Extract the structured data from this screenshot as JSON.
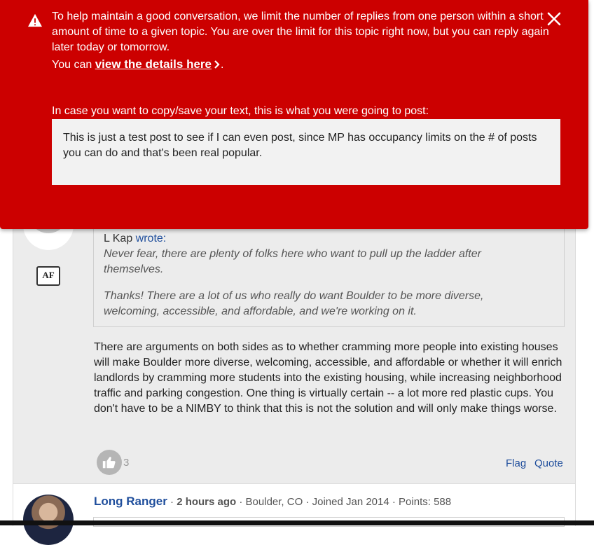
{
  "alert": {
    "message": "To help maintain a good conversation, we limit the number of replies from one person within a short amount of time to a given topic. You are over the limit for this topic right now, but you can reply again later today or tomorrow.",
    "details_prefix": "You can ",
    "details_link": "view the details here",
    "details_suffix": ".",
    "copy_label": "In case you want to copy/save your text, this is what you were going to post:",
    "draft_text": "This is just a test post to see if I can even post, since MP has occupancy limits on the # of posts you can do and that's been real popular.",
    "background_color": "#cc0000"
  },
  "post": {
    "badge_text": "AF",
    "quote": {
      "author": "L Kap",
      "wrote": "wrote:",
      "paragraph1": "Never fear, there are plenty of folks here who want to pull up the ladder after themselves.",
      "paragraph2": "Thanks! There are a lot of us who really do want Boulder to be more diverse, welcoming, accessible, and affordable, and we're working on it."
    },
    "body": "There are arguments on both sides as to whether cramming more people into existing houses will make Boulder more diverse, welcoming, accessible, and affordable or whether it will enrich landlords by cramming more students into the existing housing, while increasing neighborhood traffic and parking congestion. One thing is virtually certain -- a lot more red plastic cups. You don't have to be a NIMBY to think that this is not the solution and will only make things worse.",
    "likes": "3",
    "flag_label": "Flag",
    "quote_label": "Quote"
  },
  "next_post": {
    "username": "Long Ranger",
    "time": "2 hours ago",
    "location": "Boulder, CO",
    "joined": "Joined Jan 2014",
    "points": "Points: 588"
  },
  "icons": {
    "warning": "warning-triangle-icon",
    "close": "close-x-icon",
    "chevron": "chevron-right-icon",
    "like": "thumbs-up-icon"
  }
}
